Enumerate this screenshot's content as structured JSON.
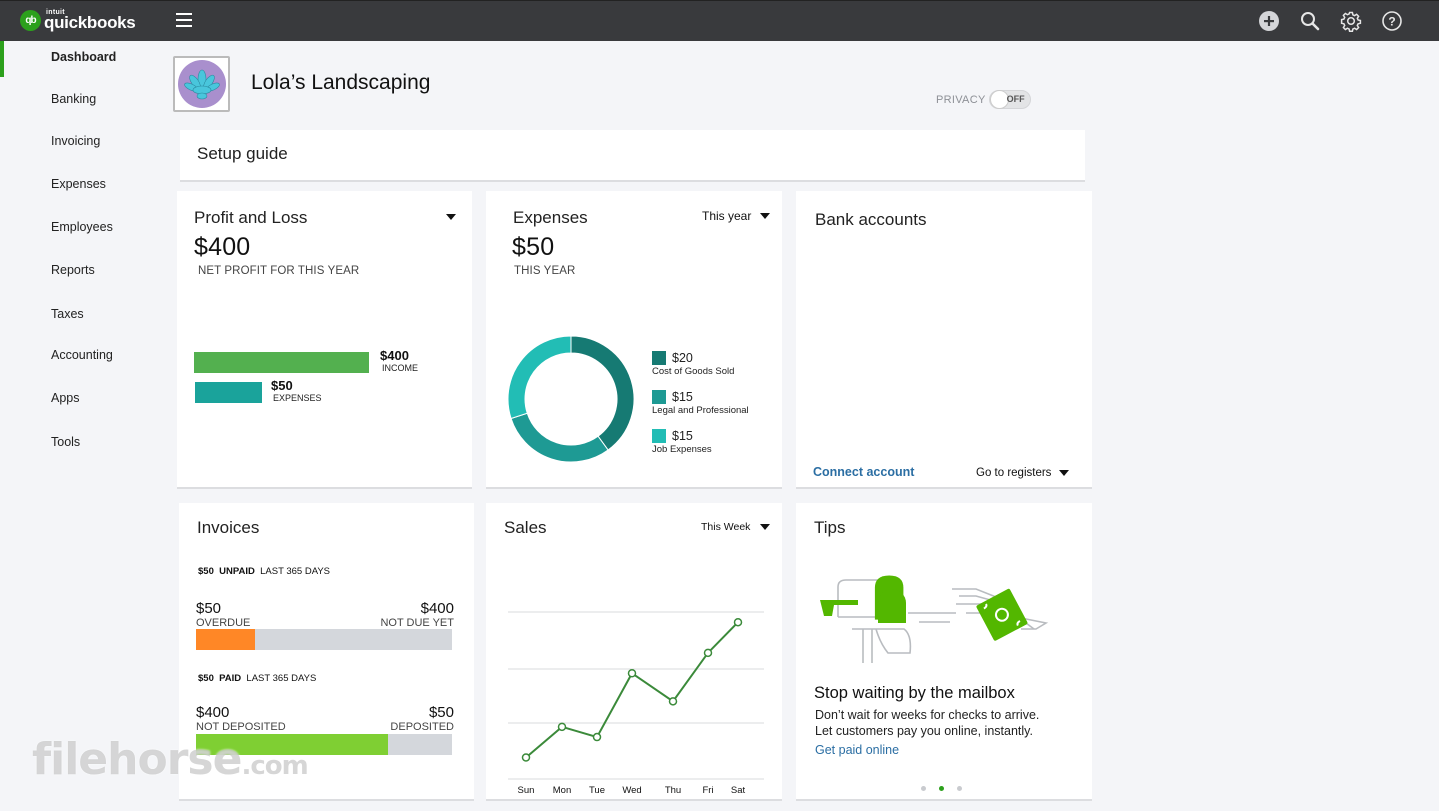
{
  "app": {
    "brand_small": "intuit",
    "brand": "quickbooks",
    "logo_mark": "qb"
  },
  "topbar": {
    "icons": [
      "menu-icon",
      "plus-icon",
      "search-icon",
      "gear-icon",
      "help-icon"
    ]
  },
  "sidebar": {
    "items": [
      {
        "label": "Dashboard",
        "active": true
      },
      {
        "label": "Banking"
      },
      {
        "label": "Invoicing"
      },
      {
        "label": "Expenses"
      },
      {
        "label": "Employees"
      },
      {
        "label": "Reports"
      },
      {
        "label": "Taxes"
      },
      {
        "label": "Accounting"
      },
      {
        "label": "Apps"
      },
      {
        "label": "Tools"
      }
    ]
  },
  "company": {
    "name": "Lola’s Landscaping"
  },
  "privacy": {
    "label": "PRIVACY",
    "state": "OFF"
  },
  "setup_guide": {
    "title": "Setup guide"
  },
  "profit_loss": {
    "title": "Profit and Loss",
    "amount": "$400",
    "caption": "NET PROFIT FOR THIS YEAR",
    "income": {
      "amount": "$400",
      "label": "INCOME",
      "value": 400
    },
    "expenses": {
      "amount": "$50",
      "label": "EXPENSES",
      "value": 50
    },
    "colors": {
      "income": "#53b04f",
      "expenses": "#1aa39b"
    }
  },
  "expenses": {
    "title": "Expenses",
    "period": "This year",
    "amount": "$50",
    "caption": "THIS YEAR",
    "legend": [
      {
        "amount": "$20",
        "label": "Cost of Goods Sold",
        "value": 20,
        "color": "#167a73"
      },
      {
        "amount": "$15",
        "label": "Legal and Professional",
        "value": 15,
        "color": "#1e9a94"
      },
      {
        "amount": "$15",
        "label": "Job Expenses",
        "value": 15,
        "color": "#22bdb5"
      }
    ]
  },
  "bank_accounts": {
    "title": "Bank accounts",
    "connect_label": "Connect account",
    "registers_label": "Go to registers"
  },
  "invoices": {
    "title": "Invoices",
    "unpaid": {
      "amount": "$50",
      "status": "UNPAID",
      "period": "LAST 365 DAYS"
    },
    "overdue": {
      "amount": "$50",
      "label": "OVERDUE"
    },
    "not_due": {
      "amount": "$400",
      "label": "NOT DUE YET"
    },
    "overdue_fraction": 0.23,
    "paid": {
      "amount": "$50",
      "status": "PAID",
      "period": "LAST 365 DAYS"
    },
    "not_deposited": {
      "amount": "$400",
      "label": "NOT DEPOSITED"
    },
    "deposited": {
      "amount": "$50",
      "label": "DEPOSITED"
    },
    "not_deposited_fraction": 0.75,
    "colors": {
      "overdue": "#ff8726",
      "not_deposited": "#7fcf33",
      "track": "#d4d7dc"
    }
  },
  "sales": {
    "title": "Sales",
    "period": "This Week"
  },
  "chart_data": {
    "type": "line",
    "title": "Sales",
    "x": [
      "Sun",
      "Mon",
      "Tue",
      "Wed",
      "Thu",
      "Fri",
      "Sat"
    ],
    "values": [
      1.0,
      2.2,
      1.8,
      4.3,
      3.2,
      5.1,
      6.3
    ],
    "ylim": [
      0,
      6.7
    ],
    "grid": true,
    "gridlines": 4,
    "color": "#3b8a3a"
  },
  "tips": {
    "title": "Tips",
    "headline": "Stop waiting by the mailbox",
    "body_line1": "Don’t wait for weeks for checks to arrive.",
    "body_line2": "Let customers pay you online, instantly.",
    "link": "Get paid online",
    "pages": 3,
    "active_page": 2
  },
  "watermark": {
    "text": "filehorse",
    "suffix": ".com"
  }
}
